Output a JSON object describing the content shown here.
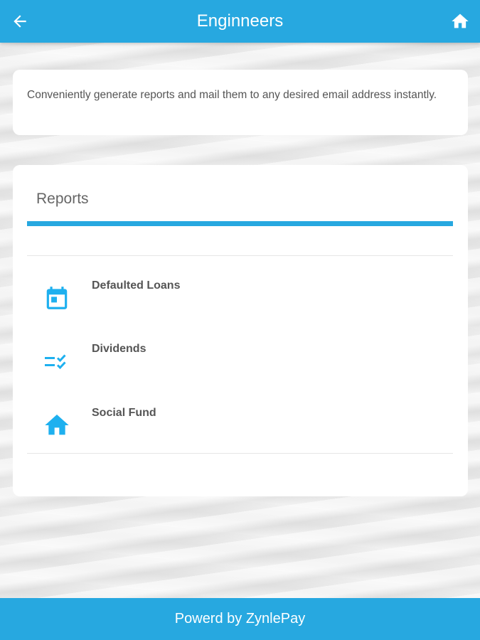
{
  "header": {
    "title": "Enginneers",
    "back_icon": "arrow-left-icon",
    "home_icon": "home-icon"
  },
  "info": {
    "text": "Conveniently generate reports and mail them to any desired email address instantly."
  },
  "reports": {
    "heading": "Reports",
    "items": [
      {
        "label": "Defaulted Loans",
        "icon": "calendar-icon"
      },
      {
        "label": "Dividends",
        "icon": "checklist-icon"
      },
      {
        "label": "Social Fund",
        "icon": "home-icon"
      }
    ]
  },
  "footer": {
    "text": "Powerd by ZynlePay"
  },
  "colors": {
    "accent": "#27a8e0",
    "icon": "#1eb0ef"
  }
}
